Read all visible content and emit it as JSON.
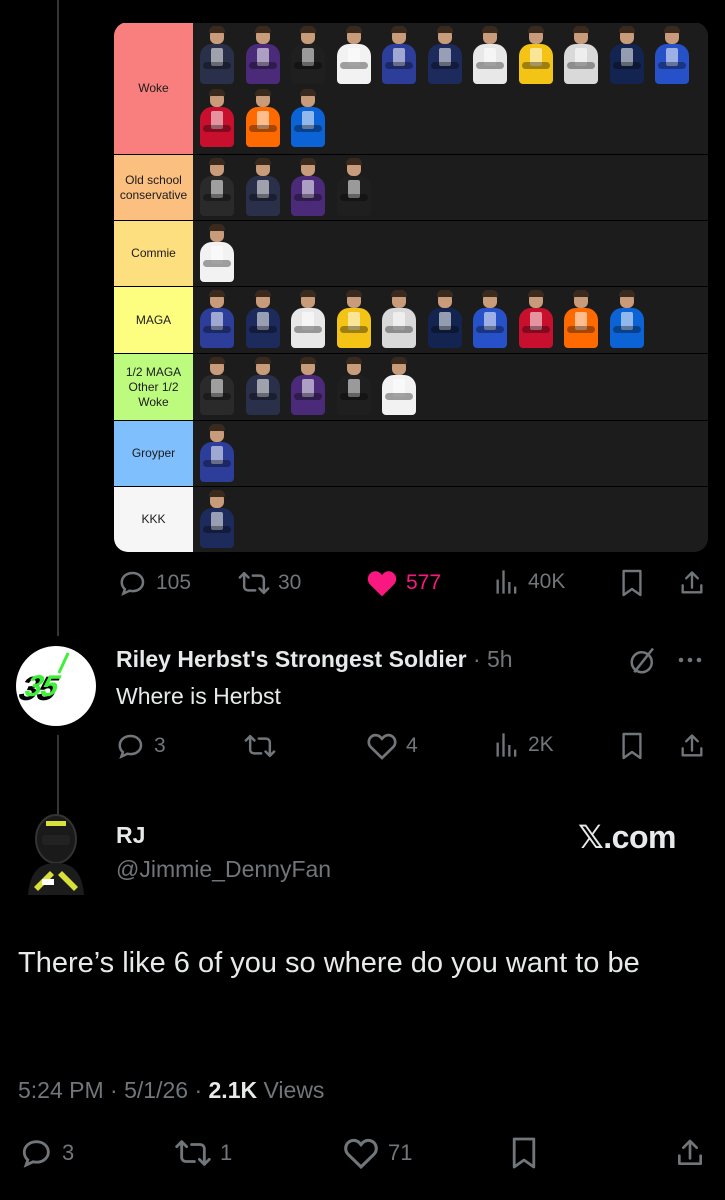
{
  "tier_list": {
    "tiers": [
      {
        "label": "Woke",
        "color": "#f97f7f"
      },
      {
        "label": "Old school conservative",
        "color": "#fbbf7f"
      },
      {
        "label": "Commie",
        "color": "#fedf7f"
      },
      {
        "label": "MAGA",
        "color": "#fdfd7f"
      },
      {
        "label": "1/2 MAGA Other 1/2 Woke",
        "color": "#bdfb7f"
      },
      {
        "label": "Groyper",
        "color": "#7fbffe"
      },
      {
        "label": "KKK",
        "color": "#f6f6f6"
      }
    ]
  },
  "post_stats": {
    "replies": "105",
    "reposts": "30",
    "likes": "577",
    "views": "40K"
  },
  "reply": {
    "avatar_text": "35",
    "author": "Riley Herbst's Strongest Soldier",
    "time": "5h",
    "text": "Where is Herbst",
    "replies": "3",
    "likes": "4",
    "views": "2K"
  },
  "main_post": {
    "name": "RJ",
    "handle": "@Jimmie_DennyFan",
    "source": "𝕏.com",
    "text": "There’s like 6 of you so where do you want to be",
    "time": "5:24 PM",
    "date": "5/1/26",
    "views_count": "2.1K",
    "views_label": "Views",
    "replies": "3",
    "reposts": "1",
    "likes": "71"
  },
  "colors": {
    "like_pink": "#f91880",
    "muted": "#71767b",
    "text": "#e7e9ea"
  }
}
